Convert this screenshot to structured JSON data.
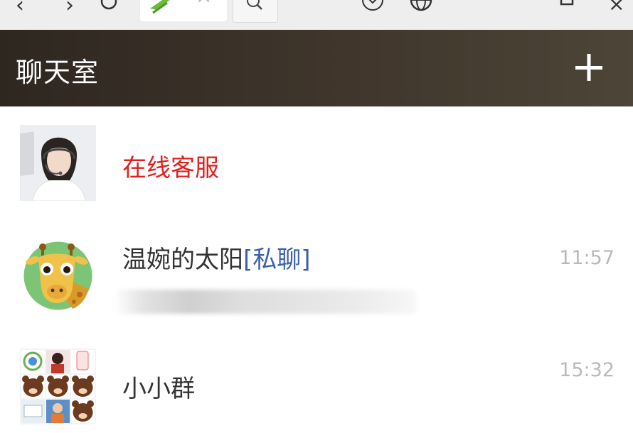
{
  "header": {
    "title": "聊天室",
    "add_label": "+"
  },
  "chats": [
    {
      "name": "在线客服",
      "name_color": "#e02020",
      "tag": "",
      "time": "",
      "preview": ""
    },
    {
      "name": "温婉的太阳",
      "tag": "[私聊]",
      "time": "11:57",
      "preview": ""
    },
    {
      "name": "小小群",
      "tag": "",
      "time": "15:32",
      "preview": ""
    }
  ],
  "icons": {
    "toolbar": [
      "back-icon",
      "forward-icon",
      "refresh-icon",
      "tab-favicon",
      "tab-close-icon",
      "search-icon",
      "download-icon",
      "globe-icon",
      "more-icon",
      "restore-window-icon",
      "close-window-icon"
    ],
    "header": "plus-icon"
  }
}
